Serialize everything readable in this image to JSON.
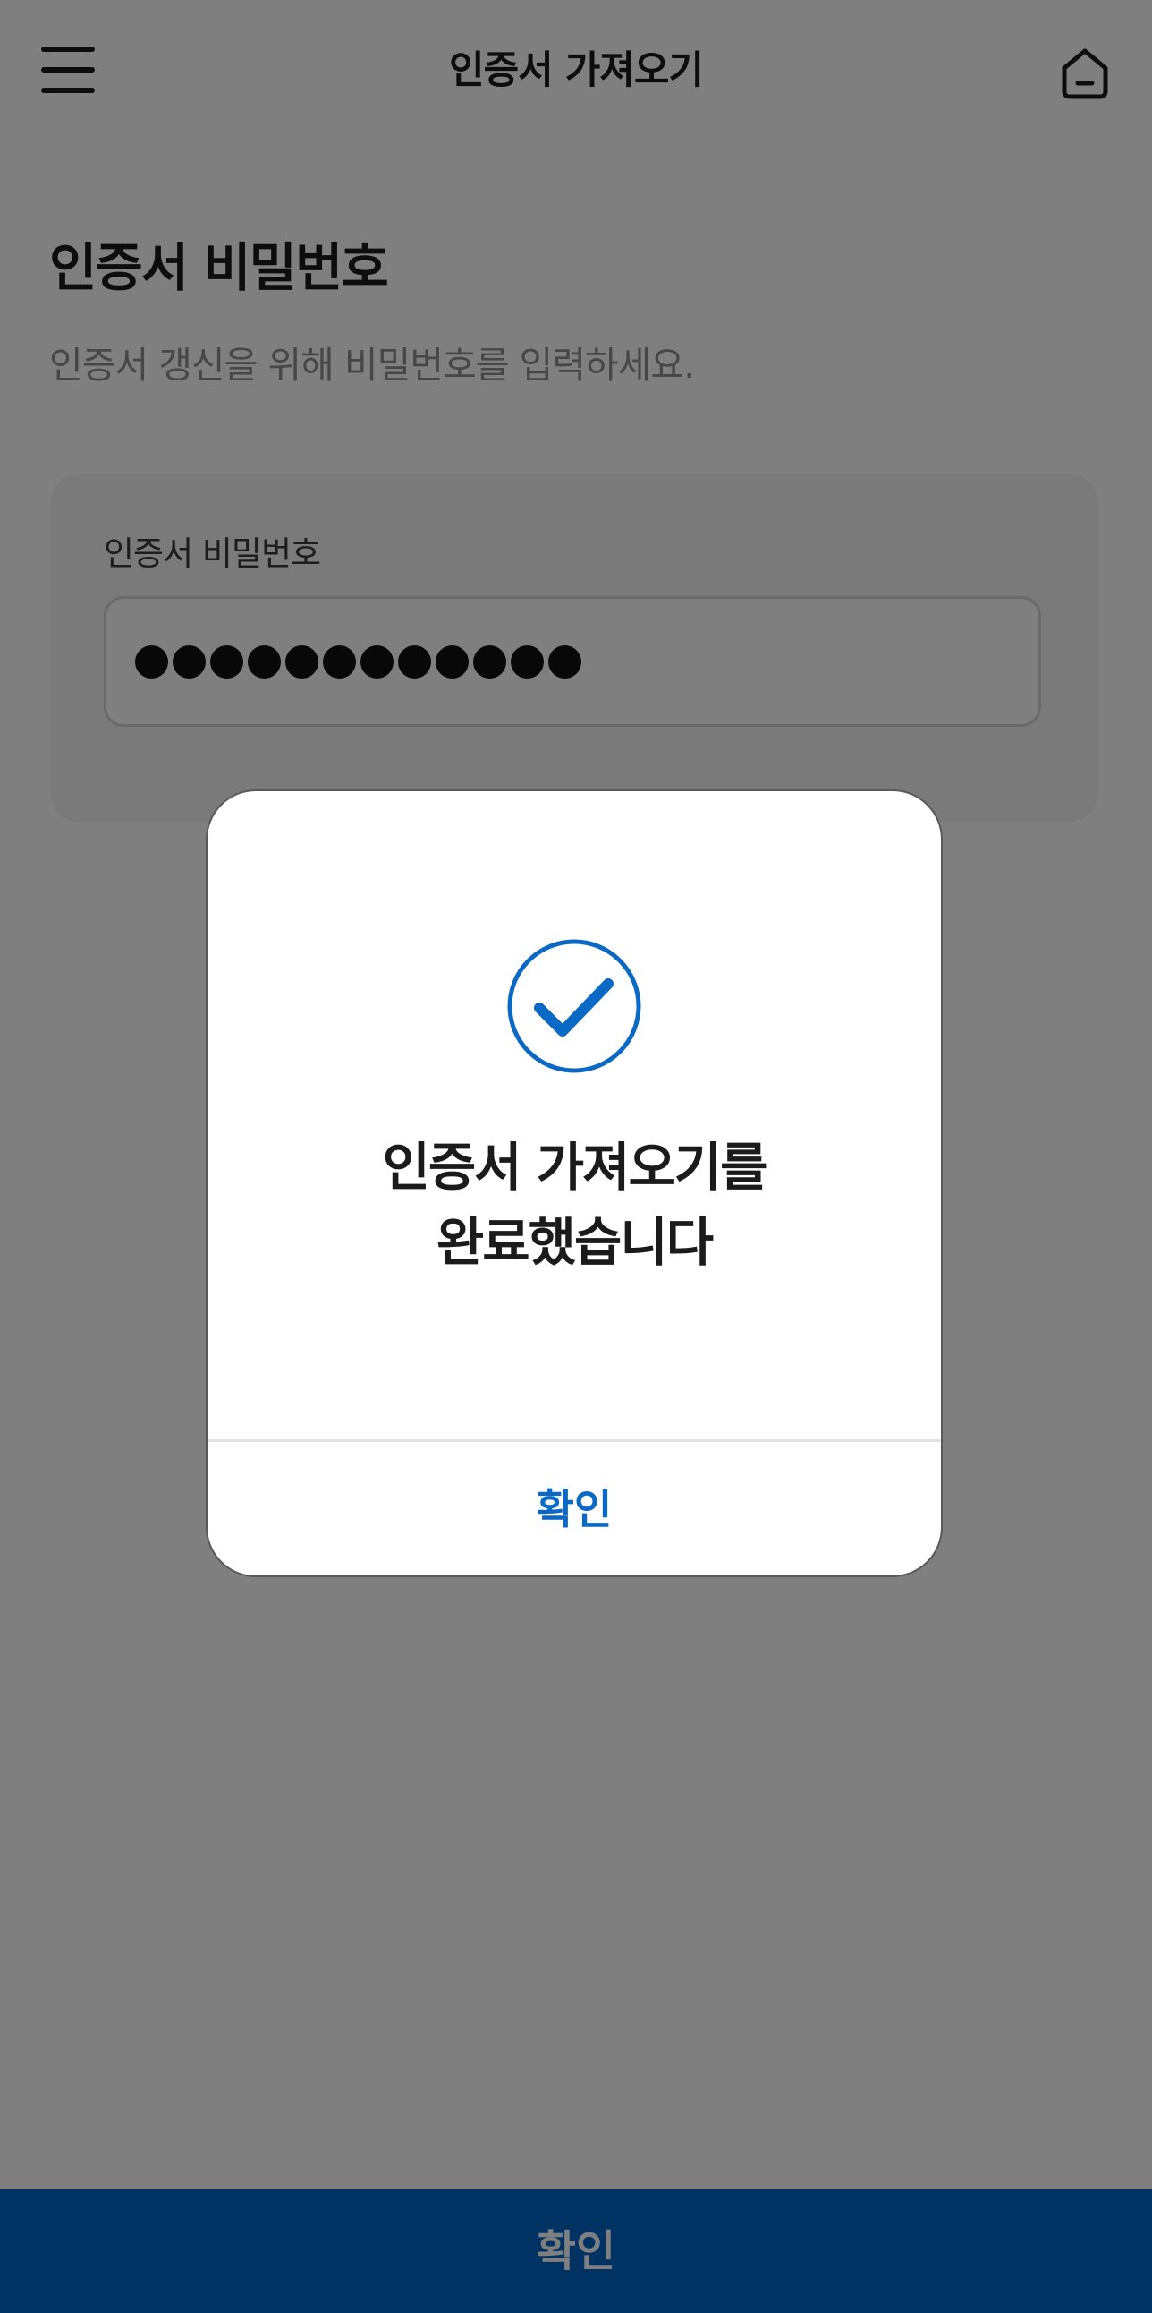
{
  "header": {
    "title": "인증서 가져오기",
    "menu_icon": "hamburger-menu-icon",
    "home_icon": "home-icon"
  },
  "main": {
    "title": "인증서 비밀번호",
    "description": "인증서 갱신을 위해 비밀번호를 입력하세요.",
    "password_field": {
      "label": "인증서 비밀번호",
      "masked_length": 12
    }
  },
  "bottom_button": {
    "label": "확인"
  },
  "dialog": {
    "icon": "check-circle-icon",
    "message_line1": "인증서 가져오기를",
    "message_line2": "완료했습니다",
    "confirm_label": "확인"
  },
  "colors": {
    "accent": "#0067c8",
    "dialog_link": "#0a69c5",
    "overlay": "rgba(0,0,0,0.5)",
    "text_dark": "#1b1b1b",
    "text_muted": "#8e8e8e"
  }
}
